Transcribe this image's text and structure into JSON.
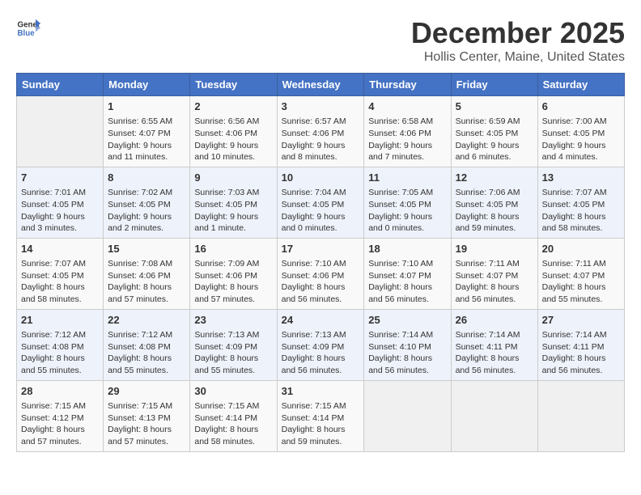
{
  "header": {
    "logo_general": "General",
    "logo_blue": "Blue",
    "title": "December 2025",
    "subtitle": "Hollis Center, Maine, United States"
  },
  "calendar": {
    "days_of_week": [
      "Sunday",
      "Monday",
      "Tuesday",
      "Wednesday",
      "Thursday",
      "Friday",
      "Saturday"
    ],
    "weeks": [
      [
        {
          "day": "",
          "info": ""
        },
        {
          "day": "1",
          "info": "Sunrise: 6:55 AM\nSunset: 4:07 PM\nDaylight: 9 hours and 11 minutes."
        },
        {
          "day": "2",
          "info": "Sunrise: 6:56 AM\nSunset: 4:06 PM\nDaylight: 9 hours and 10 minutes."
        },
        {
          "day": "3",
          "info": "Sunrise: 6:57 AM\nSunset: 4:06 PM\nDaylight: 9 hours and 8 minutes."
        },
        {
          "day": "4",
          "info": "Sunrise: 6:58 AM\nSunset: 4:06 PM\nDaylight: 9 hours and 7 minutes."
        },
        {
          "day": "5",
          "info": "Sunrise: 6:59 AM\nSunset: 4:05 PM\nDaylight: 9 hours and 6 minutes."
        },
        {
          "day": "6",
          "info": "Sunrise: 7:00 AM\nSunset: 4:05 PM\nDaylight: 9 hours and 4 minutes."
        }
      ],
      [
        {
          "day": "7",
          "info": "Sunrise: 7:01 AM\nSunset: 4:05 PM\nDaylight: 9 hours and 3 minutes."
        },
        {
          "day": "8",
          "info": "Sunrise: 7:02 AM\nSunset: 4:05 PM\nDaylight: 9 hours and 2 minutes."
        },
        {
          "day": "9",
          "info": "Sunrise: 7:03 AM\nSunset: 4:05 PM\nDaylight: 9 hours and 1 minute."
        },
        {
          "day": "10",
          "info": "Sunrise: 7:04 AM\nSunset: 4:05 PM\nDaylight: 9 hours and 0 minutes."
        },
        {
          "day": "11",
          "info": "Sunrise: 7:05 AM\nSunset: 4:05 PM\nDaylight: 9 hours and 0 minutes."
        },
        {
          "day": "12",
          "info": "Sunrise: 7:06 AM\nSunset: 4:05 PM\nDaylight: 8 hours and 59 minutes."
        },
        {
          "day": "13",
          "info": "Sunrise: 7:07 AM\nSunset: 4:05 PM\nDaylight: 8 hours and 58 minutes."
        }
      ],
      [
        {
          "day": "14",
          "info": "Sunrise: 7:07 AM\nSunset: 4:05 PM\nDaylight: 8 hours and 58 minutes."
        },
        {
          "day": "15",
          "info": "Sunrise: 7:08 AM\nSunset: 4:06 PM\nDaylight: 8 hours and 57 minutes."
        },
        {
          "day": "16",
          "info": "Sunrise: 7:09 AM\nSunset: 4:06 PM\nDaylight: 8 hours and 57 minutes."
        },
        {
          "day": "17",
          "info": "Sunrise: 7:10 AM\nSunset: 4:06 PM\nDaylight: 8 hours and 56 minutes."
        },
        {
          "day": "18",
          "info": "Sunrise: 7:10 AM\nSunset: 4:07 PM\nDaylight: 8 hours and 56 minutes."
        },
        {
          "day": "19",
          "info": "Sunrise: 7:11 AM\nSunset: 4:07 PM\nDaylight: 8 hours and 56 minutes."
        },
        {
          "day": "20",
          "info": "Sunrise: 7:11 AM\nSunset: 4:07 PM\nDaylight: 8 hours and 55 minutes."
        }
      ],
      [
        {
          "day": "21",
          "info": "Sunrise: 7:12 AM\nSunset: 4:08 PM\nDaylight: 8 hours and 55 minutes."
        },
        {
          "day": "22",
          "info": "Sunrise: 7:12 AM\nSunset: 4:08 PM\nDaylight: 8 hours and 55 minutes."
        },
        {
          "day": "23",
          "info": "Sunrise: 7:13 AM\nSunset: 4:09 PM\nDaylight: 8 hours and 55 minutes."
        },
        {
          "day": "24",
          "info": "Sunrise: 7:13 AM\nSunset: 4:09 PM\nDaylight: 8 hours and 56 minutes."
        },
        {
          "day": "25",
          "info": "Sunrise: 7:14 AM\nSunset: 4:10 PM\nDaylight: 8 hours and 56 minutes."
        },
        {
          "day": "26",
          "info": "Sunrise: 7:14 AM\nSunset: 4:11 PM\nDaylight: 8 hours and 56 minutes."
        },
        {
          "day": "27",
          "info": "Sunrise: 7:14 AM\nSunset: 4:11 PM\nDaylight: 8 hours and 56 minutes."
        }
      ],
      [
        {
          "day": "28",
          "info": "Sunrise: 7:15 AM\nSunset: 4:12 PM\nDaylight: 8 hours and 57 minutes."
        },
        {
          "day": "29",
          "info": "Sunrise: 7:15 AM\nSunset: 4:13 PM\nDaylight: 8 hours and 57 minutes."
        },
        {
          "day": "30",
          "info": "Sunrise: 7:15 AM\nSunset: 4:14 PM\nDaylight: 8 hours and 58 minutes."
        },
        {
          "day": "31",
          "info": "Sunrise: 7:15 AM\nSunset: 4:14 PM\nDaylight: 8 hours and 59 minutes."
        },
        {
          "day": "",
          "info": ""
        },
        {
          "day": "",
          "info": ""
        },
        {
          "day": "",
          "info": ""
        }
      ]
    ]
  }
}
